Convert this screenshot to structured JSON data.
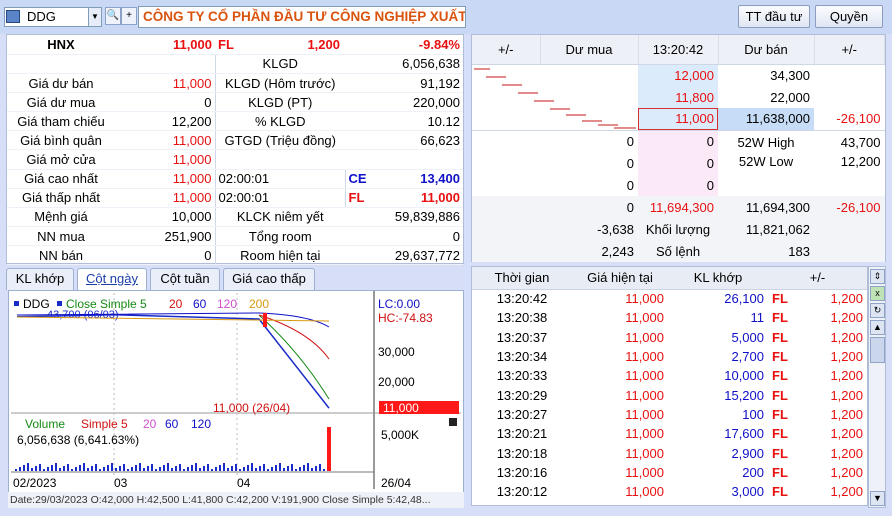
{
  "toolbar": {
    "symbol": "DDG",
    "company_name": "CÔNG TY CỔ PHẦN ĐẦU TƯ CÔNG NGHIỆP XUẤT",
    "invest_info_button": "TT đầu tư",
    "rights_button": "Quyền"
  },
  "info": {
    "exchange": "HNX",
    "price": "11,000",
    "fl": "FL",
    "change": "1,200",
    "pct": "-9.84%",
    "klgd_label": "KLGD",
    "klgd_value": "6,056,638",
    "rows": [
      {
        "l": "Giá dư bán",
        "v": "11,000",
        "l2": "KLGD (Hôm trước)",
        "v2": "91,192"
      },
      {
        "l": "Giá dư mua",
        "v": "0",
        "l2": "KLGD (PT)",
        "v2": "220,000"
      },
      {
        "l": "Giá tham chiếu",
        "v": "12,200",
        "l2": "% KLGD",
        "v2": "10.12"
      },
      {
        "l": "Giá bình quân",
        "v": "11,000",
        "l2": "GTGD (Triệu đồng)",
        "v2": "66,623"
      }
    ],
    "open_label": "Giá mở cửa",
    "open_value": "11,000",
    "high_label": "Giá cao nhất",
    "high_value": "11,000",
    "high_time": "02:00:01",
    "ce_label": "CE",
    "ce_value": "13,400",
    "low_label": "Giá thấp nhất",
    "low_value": "11,000",
    "low_time": "02:00:01",
    "fl_label": "FL",
    "fl_value": "11,000",
    "par_label": "Mệnh giá",
    "par_value": "10,000",
    "listed_label": "KLCK niêm yết",
    "listed_value": "59,839,886",
    "nn_buy_label": "NN mua",
    "nn_buy_value": "251,900",
    "room_label": "Tổng room",
    "room_value": "0",
    "nn_sell_label": "NN bán",
    "nn_sell_value": "0",
    "room_now_label": "Room hiện tại",
    "room_now_value": "29,637,772"
  },
  "book": {
    "headers": [
      "+/-",
      "Dư mua",
      "13:20:42",
      "Dư bán",
      "+/-"
    ],
    "ask_rows": [
      {
        "price": "12,000",
        "vol": "34,300",
        "chg": ""
      },
      {
        "price": "11,800",
        "vol": "22,000",
        "chg": ""
      },
      {
        "price": "11,000",
        "vol": "11,638,000",
        "chg": "-26,100"
      }
    ],
    "bid_rows": [
      {
        "vol": "0",
        "price": "0"
      },
      {
        "vol": "0",
        "price": "0"
      },
      {
        "vol": "0",
        "price": "0"
      }
    ],
    "w52_high_label": "52W High",
    "w52_high_value": "43,700",
    "w52_low_label": "52W Low",
    "w52_low_value": "12,200",
    "total_row": {
      "a": "0",
      "b": "11,694,300",
      "c": "11,694,300",
      "d": "-26,100"
    },
    "vol_row": {
      "a": "-3,638",
      "label": "Khối lượng",
      "c": "11,821,062"
    },
    "order_row": {
      "a": "2,243",
      "label": "Số lệnh",
      "c": "183"
    }
  },
  "tabs": [
    "KL khớp",
    "Cột ngày",
    "Cột tuần",
    "Giá cao thấp"
  ],
  "chart": {
    "legend_symbol": "DDG",
    "legend_ma": "Close Simple 5",
    "legend_p1": "20",
    "legend_p2": "60",
    "legend_p3": "120",
    "legend_p4": "200",
    "lc": "LC:0.00",
    "hc": "HC:-74.83",
    "y_ticks": [
      "30,000",
      "20,000"
    ],
    "last_price_tag": "11,000",
    "annotation_top": "43,700 (06/03)",
    "annotation_bottom": "11,000 (26/04)",
    "vol_legend": "Volume",
    "vol_ma": "Simple 5",
    "vol_p1": "20",
    "vol_p2": "60",
    "vol_p3": "120",
    "vol_value": "6,056,638 (6,641.63%)",
    "vol_tick": "5,000K",
    "x_ticks": [
      "02/2023",
      "03",
      "04",
      "26/04"
    ],
    "status": "Date:29/03/2023  O:42,000  H:42,500  L:41,800  C:42,200  V:191,900  Close Simple 5:42,48..."
  },
  "chart_data": {
    "type": "line",
    "x": [
      "02/2023",
      "03",
      "04",
      "26/04"
    ],
    "series": [
      {
        "name": "DDG",
        "values": [
          43000,
          43700,
          42200,
          11000
        ]
      }
    ],
    "ylim": [
      10000,
      45000
    ]
  },
  "trades": {
    "headers": [
      "Thời gian",
      "Giá hiện tại",
      "KL khớp",
      "+/-"
    ],
    "rows": [
      [
        "13:20:42",
        "11,000",
        "26,100",
        "FL",
        "1,200"
      ],
      [
        "13:20:38",
        "11,000",
        "11",
        "FL",
        "1,200"
      ],
      [
        "13:20:37",
        "11,000",
        "5,000",
        "FL",
        "1,200"
      ],
      [
        "13:20:34",
        "11,000",
        "2,700",
        "FL",
        "1,200"
      ],
      [
        "13:20:33",
        "11,000",
        "10,000",
        "FL",
        "1,200"
      ],
      [
        "13:20:29",
        "11,000",
        "15,200",
        "FL",
        "1,200"
      ],
      [
        "13:20:27",
        "11,000",
        "100",
        "FL",
        "1,200"
      ],
      [
        "13:20:21",
        "11,000",
        "17,600",
        "FL",
        "1,200"
      ],
      [
        "13:20:18",
        "11,000",
        "2,900",
        "FL",
        "1,200"
      ],
      [
        "13:20:16",
        "11,000",
        "200",
        "FL",
        "1,200"
      ],
      [
        "13:20:12",
        "11,000",
        "3,000",
        "FL",
        "1,200"
      ]
    ]
  }
}
